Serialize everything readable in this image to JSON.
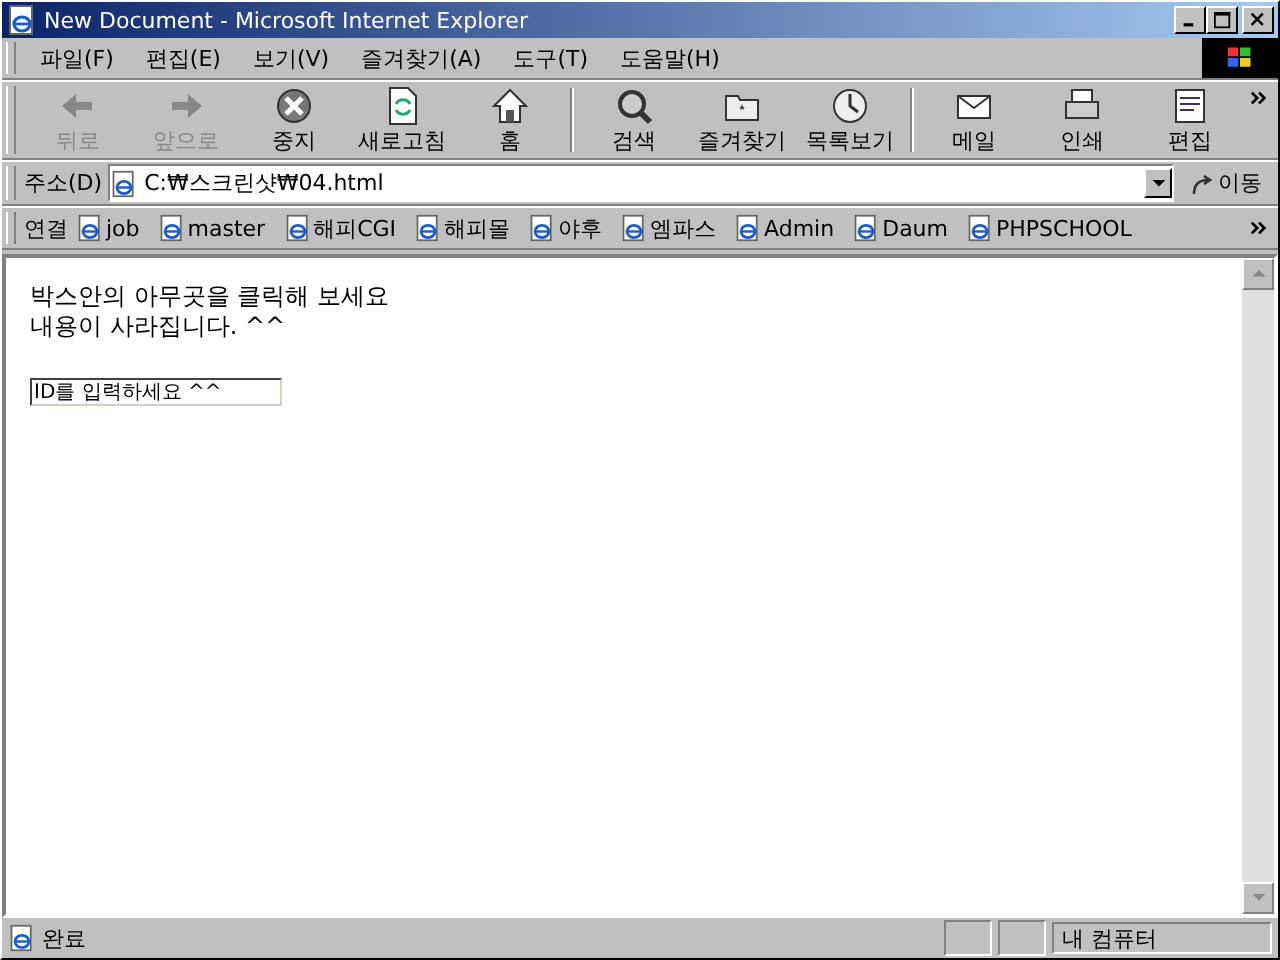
{
  "window": {
    "title": "New Document - Microsoft Internet Explorer"
  },
  "menu": [
    "파일(F)",
    "편집(E)",
    "보기(V)",
    "즐겨찾기(A)",
    "도구(T)",
    "도움말(H)"
  ],
  "toolbar": [
    {
      "kind": "back",
      "label": "뒤로",
      "disabled": true
    },
    {
      "kind": "forward",
      "label": "앞으로",
      "disabled": true
    },
    {
      "kind": "stop",
      "label": "중지",
      "disabled": false
    },
    {
      "kind": "refresh",
      "label": "새로고침",
      "disabled": false
    },
    {
      "kind": "home",
      "label": "홈",
      "disabled": false
    },
    {
      "kind": "search",
      "label": "검색",
      "disabled": false
    },
    {
      "kind": "favorites",
      "label": "즐겨찾기",
      "disabled": false
    },
    {
      "kind": "history",
      "label": "목록보기",
      "disabled": false
    },
    {
      "kind": "mail",
      "label": "메일",
      "disabled": false
    },
    {
      "kind": "print",
      "label": "인쇄",
      "disabled": false
    },
    {
      "kind": "edit",
      "label": "편집",
      "disabled": false
    }
  ],
  "address": {
    "label": "주소(D)",
    "value": "C:₩스크린샷₩04.html",
    "go": "이동"
  },
  "links": {
    "label": "연결",
    "items": [
      "job",
      "master",
      "해피CGI",
      "해피몰",
      "야후",
      "엠파스",
      "Admin",
      "Daum",
      "PHPSCHOOL"
    ]
  },
  "content": {
    "lines": [
      "박스안의 아무곳을 클릭해 보세요",
      "내용이 사라집니다. ^^"
    ],
    "input_value": "ID를 입력하세요 ^^"
  },
  "status_bar": {
    "text": "완료",
    "zone": "내 컴퓨터"
  }
}
